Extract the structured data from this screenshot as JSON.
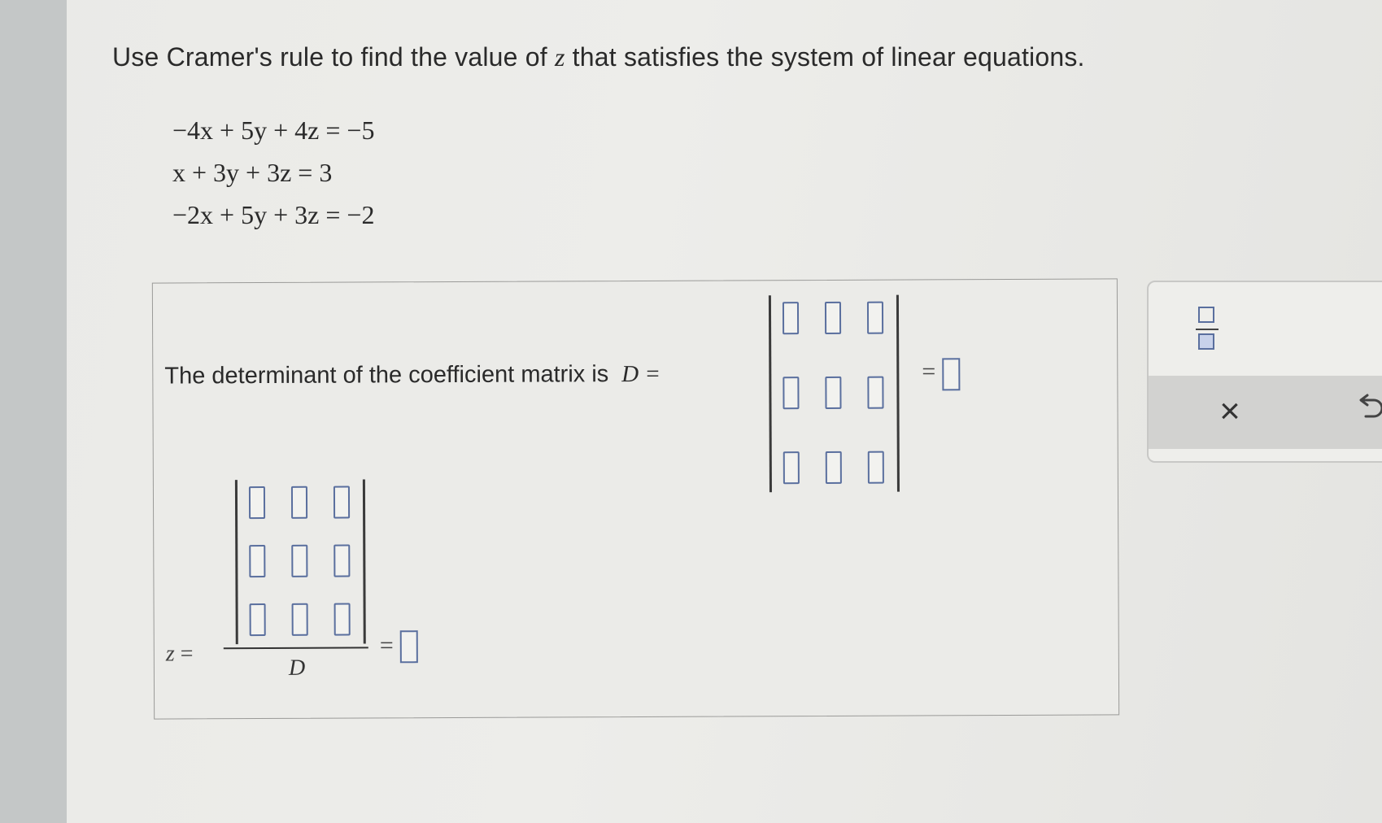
{
  "question": {
    "prefix": "Use Cramer's rule to find the value of ",
    "variable": "z",
    "suffix": " that satisfies the system of linear equations."
  },
  "equations": [
    "−4x + 5y + 4z = −5",
    "x + 3y + 3z = 3",
    "−2x + 5y + 3z = −2"
  ],
  "determinant": {
    "label": "The determinant of the coefficient matrix is",
    "symbol": "D =",
    "equals": "=",
    "matrix_cells": [
      "",
      "",
      "",
      "",
      "",
      "",
      "",
      "",
      ""
    ],
    "result": ""
  },
  "z_fraction": {
    "label_var": "z",
    "label_eq": "=",
    "matrix_cells": [
      "",
      "",
      "",
      "",
      "",
      "",
      "",
      "",
      ""
    ],
    "denominator": "D",
    "equals": "=",
    "result": ""
  },
  "tools": {
    "fraction_icon": "fraction-template-icon",
    "clear_label": "×",
    "undo_icon": "undo-icon"
  }
}
